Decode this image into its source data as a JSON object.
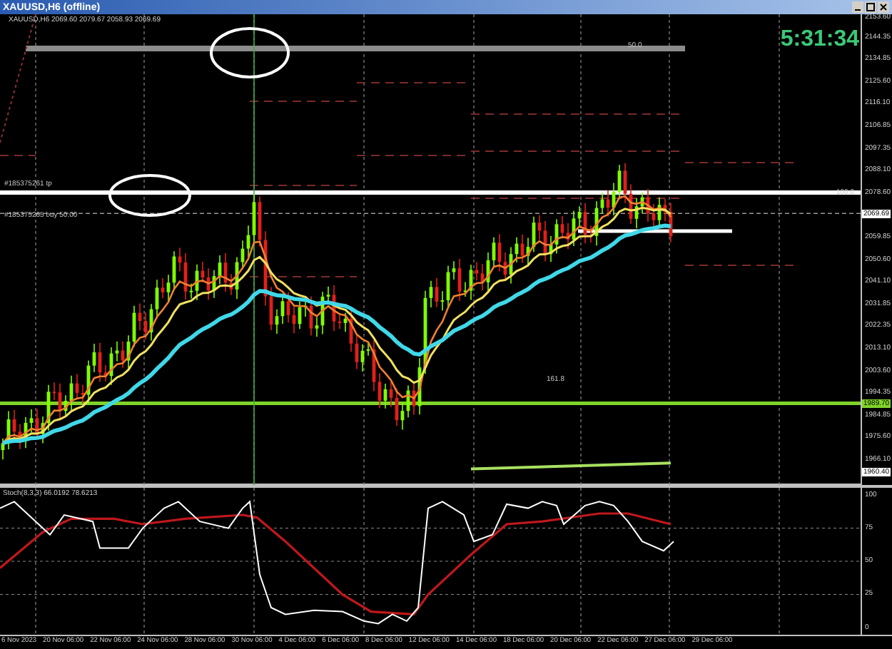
{
  "window": {
    "title": "XAUUSD,H6 (offline)"
  },
  "chart": {
    "info": "XAUUSD,H6  2069.60 2079.67 2058.93 2069.69",
    "clock": "5:31:34",
    "labels": [
      {
        "text": "#185375261 tp"
      },
      {
        "text": "#185375265 buy 50.00"
      },
      {
        "text": "50.0"
      },
      {
        "text": "161.8"
      },
      {
        "text": "100.0"
      }
    ],
    "price_ticks": [
      "2153.60",
      "2144.35",
      "2134.85",
      "2125.60",
      "2116.10",
      "2106.85",
      "2097.35",
      "2088.10",
      "2078.60",
      "2059.85",
      "2050.60",
      "2041.10",
      "2031.85",
      "2022.35",
      "2013.10",
      "2003.60",
      "1994.35",
      "1984.85",
      "1975.60",
      "1966.10"
    ],
    "price_markers": [
      {
        "text": "2069.69",
        "color": "#ffffff"
      },
      {
        "text": "1989.70",
        "color": "#7fd32a"
      },
      {
        "text": "1960.40",
        "color": "#ffffff"
      }
    ]
  },
  "stochastic": {
    "label": "Stoch(8,3,3) 66.0192 78.6213",
    "ticks": [
      "100",
      "75",
      "50",
      "25",
      "0"
    ]
  },
  "time_axis": {
    "labels": [
      "6 Nov 2023",
      "20 Nov 06:00",
      "22 Nov 06:00",
      "24 Nov 06:00",
      "28 Nov 06:00",
      "30 Nov 06:00",
      "4 Dec 06:00",
      "6 Dec 06:00",
      "8 Dec 06:00",
      "12 Dec 06:00",
      "14 Dec 06:00",
      "18 Dec 06:00",
      "20 Dec 06:00",
      "22 Dec 06:00",
      "27 Dec 06:00",
      "29 Dec 06:00"
    ]
  }
}
